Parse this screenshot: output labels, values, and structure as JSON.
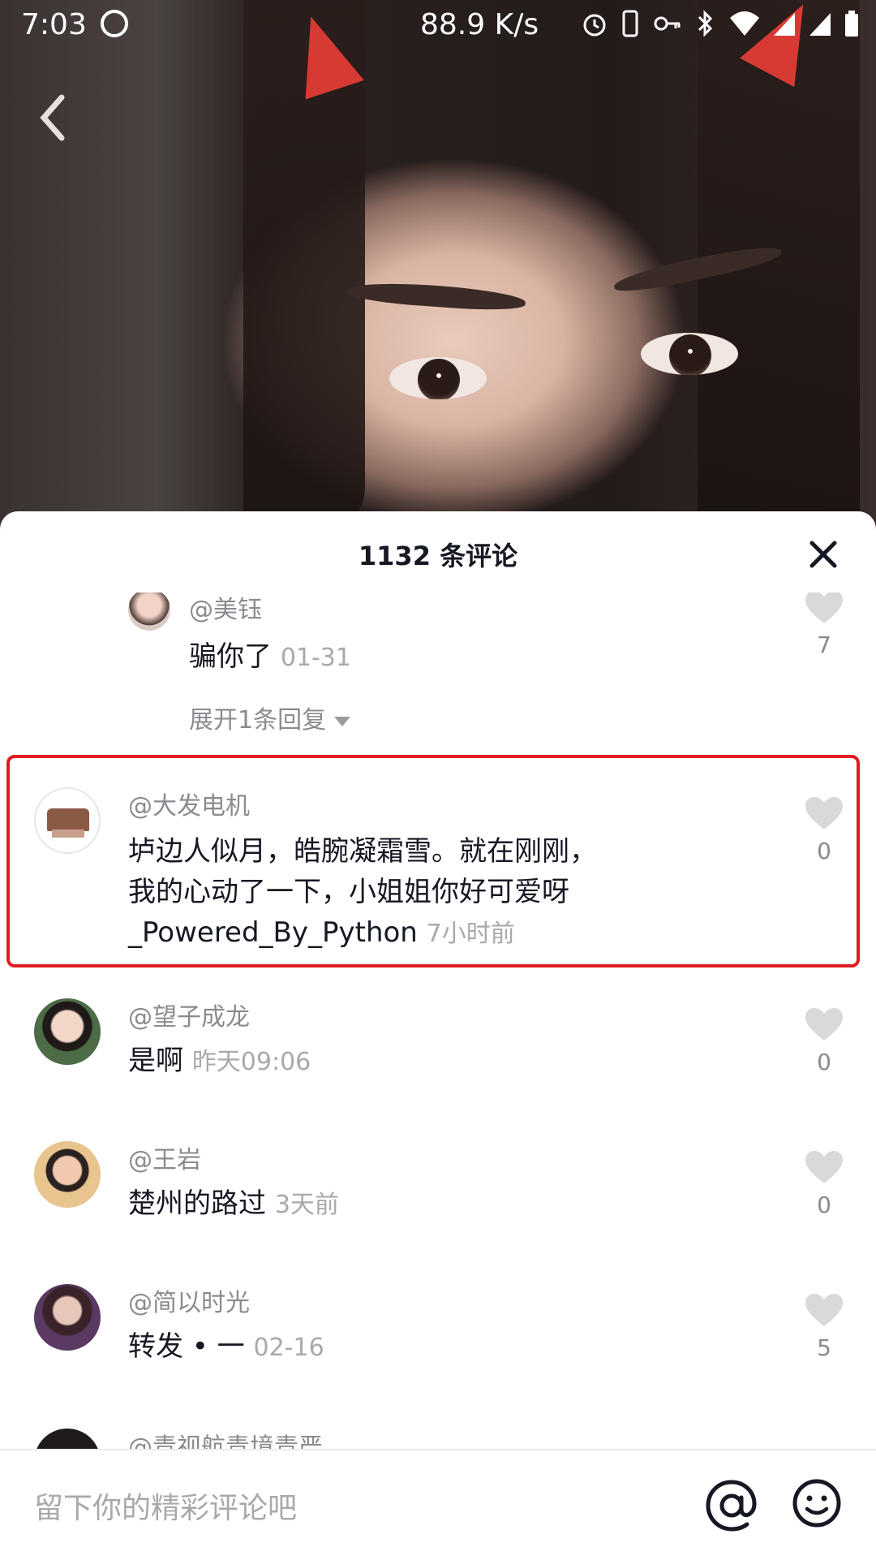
{
  "status_bar": {
    "time": "7:03",
    "net_speed": "88.9 K/s",
    "icons": [
      "sync-icon",
      "alarm-icon",
      "phone-icon",
      "vpn-key-icon",
      "bluetooth-icon",
      "wifi-icon",
      "signal-icon",
      "signal-icon",
      "battery-icon"
    ]
  },
  "video": {
    "back_icon": "chevron-left-icon"
  },
  "comments_panel": {
    "title": "1132 条评论",
    "close_icon": "close-icon",
    "comments": [
      {
        "username": "@美钰",
        "content": "骗你了",
        "time": "01-31",
        "likes": "7",
        "expand_label": "展开1条回复"
      },
      {
        "username": "@大发电机",
        "content_lines": [
          "垆边人似月，皓腕凝霜雪。就在刚刚，",
          "我的心动了一下，小姐姐你好可爱呀",
          "_Powered_By_Python"
        ],
        "time": "7小时前",
        "likes": "0",
        "highlighted": true
      },
      {
        "username": "@望子成龙",
        "content": "是啊",
        "time": "昨天09:06",
        "likes": "0"
      },
      {
        "username": "@王岩",
        "content": "楚州的路过",
        "time": "3天前",
        "likes": "0"
      },
      {
        "username": "@简以时光",
        "content": "转发 • 一",
        "time": "02-16",
        "likes": "5"
      },
      {
        "username": "@青视航青境青严"
      }
    ]
  },
  "input_bar": {
    "placeholder": "留下你的精彩评论吧",
    "at_icon": "at-icon",
    "emoji_icon": "emoji-icon"
  },
  "colors": {
    "highlight_border": "#e21b22",
    "username": "#8a8b91",
    "content": "#161823",
    "time": "#a8a9ad",
    "heart": "#d9d9dc"
  }
}
